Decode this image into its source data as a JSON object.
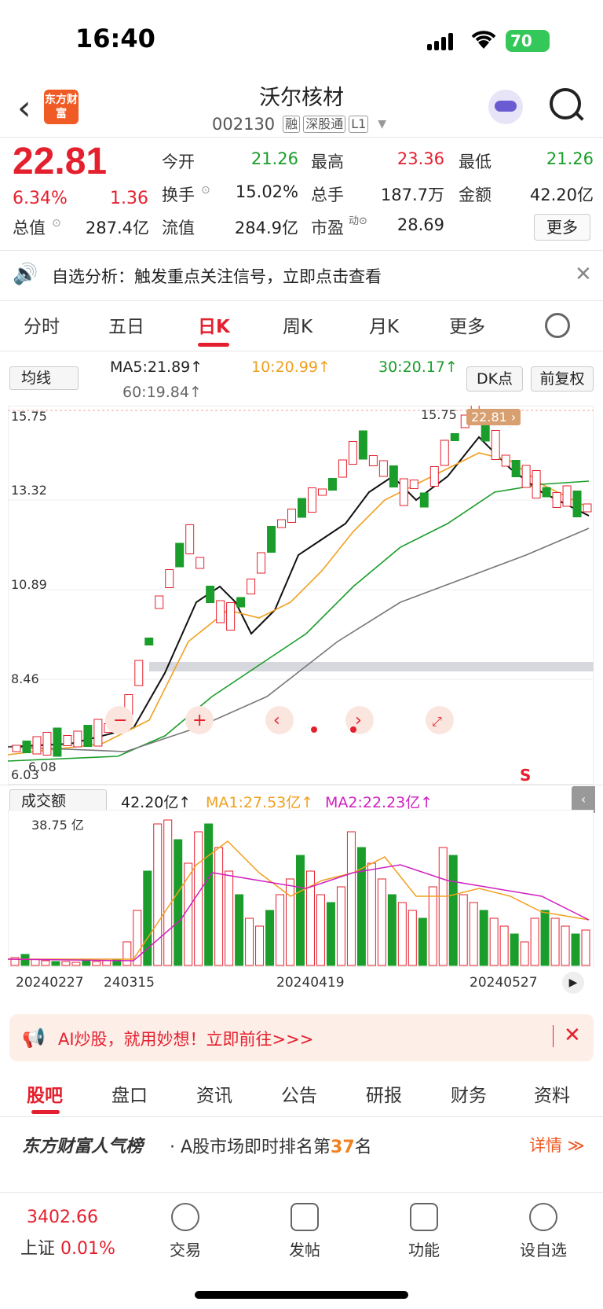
{
  "status_bar": {
    "time": "16:40",
    "battery": "70"
  },
  "header": {
    "logo_text": "东方财富",
    "title": "沃尔核材",
    "code": "002130",
    "tags": [
      "融",
      "深股通",
      "L1"
    ]
  },
  "quote": {
    "price": "22.81",
    "change_pct": "6.34%",
    "change": "1.36",
    "fields": [
      {
        "label": "今开",
        "value": "21.26",
        "color": "green"
      },
      {
        "label": "最高",
        "value": "23.36",
        "color": "red"
      },
      {
        "label": "最低",
        "value": "21.26",
        "color": "green"
      },
      {
        "label": "换手",
        "value": "15.02%",
        "color": ""
      },
      {
        "label": "总手",
        "value": "187.7万",
        "color": ""
      },
      {
        "label": "金额",
        "value": "42.20亿",
        "color": ""
      },
      {
        "label": "总值",
        "value": "287.4亿",
        "color": ""
      },
      {
        "label": "流值",
        "value": "284.9亿",
        "color": ""
      },
      {
        "label": "市盈",
        "value": "28.69",
        "color": ""
      }
    ],
    "more_label": "更多"
  },
  "notice": {
    "text": "自选分析：触发重点关注信号，立即点击查看"
  },
  "tabs": [
    "分时",
    "五日",
    "日K",
    "周K",
    "月K",
    "更多"
  ],
  "ma_row": {
    "select": "均线",
    "ma5": "MA5:21.89↑",
    "ma10": "10:20.99↑",
    "ma30": "30:20.17↑",
    "ma60": "60:19.84↑",
    "dk_label": "DK点",
    "fq_label": "前复权"
  },
  "kchart": {
    "y_ticks": [
      "15.75",
      "13.32",
      "10.89",
      "8.46",
      "6.03"
    ],
    "high_label": "15.75",
    "low_label": "6.08",
    "price_tag": "22.81 ›",
    "s_label": "S"
  },
  "vchart": {
    "select": "成交额",
    "value": "42.20亿↑",
    "ma1": "MA1:27.53亿↑",
    "ma2": "MA2:22.23亿↑",
    "y_top": "38.75 亿",
    "x_ticks": [
      "20240227",
      "240315",
      "20240419",
      "20240527"
    ]
  },
  "ad": {
    "text": "AI炒股，就用妙想！立即前往>>>"
  },
  "bottom_tabs": [
    "股吧",
    "盘口",
    "资讯",
    "公告",
    "研报",
    "财务",
    "资料"
  ],
  "rank": {
    "brand": "东方财富人气榜",
    "prefix": "· A股市场即时排名第",
    "num": "37",
    "suffix": "名",
    "link": "详情 ≫"
  },
  "navbar": {
    "index_value": "3402.66",
    "index_name": "上证",
    "index_pct": "0.01%",
    "items": [
      "交易",
      "发帖",
      "功能",
      "设自选"
    ]
  },
  "chart_data": {
    "type": "candlestick",
    "y_range": [
      6.03,
      15.75
    ],
    "series": [
      {
        "name": "MA5",
        "value": "21.89"
      },
      {
        "name": "MA10",
        "value": "20.99"
      },
      {
        "name": "MA30",
        "value": "20.17"
      },
      {
        "name": "MA60",
        "value": "19.84"
      }
    ],
    "volume_range_top": "38.75亿"
  }
}
